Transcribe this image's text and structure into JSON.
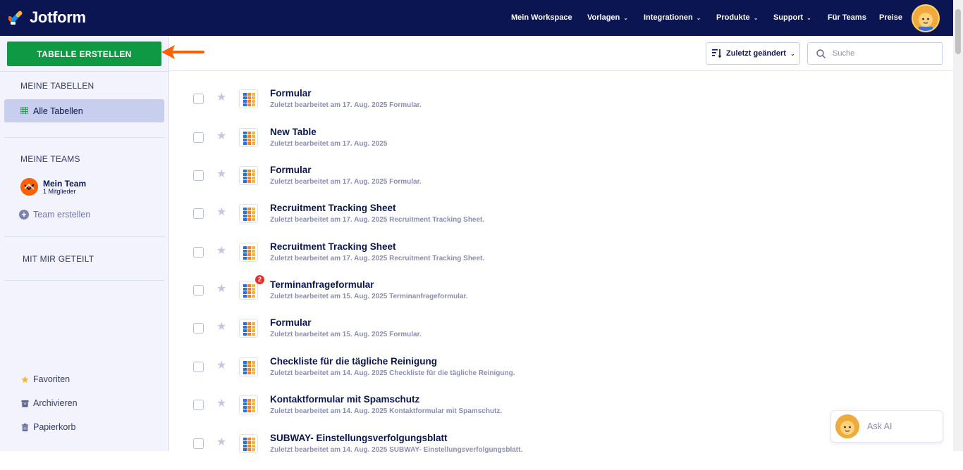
{
  "app": {
    "brand": "Jotform"
  },
  "nav": {
    "items": [
      {
        "label": "Mein Workspace",
        "dropdown": false
      },
      {
        "label": "Vorlagen",
        "dropdown": true
      },
      {
        "label": "Integrationen",
        "dropdown": true
      },
      {
        "label": "Produkte",
        "dropdown": true
      },
      {
        "label": "Support",
        "dropdown": true
      },
      {
        "label": "Für Teams",
        "dropdown": false
      },
      {
        "label": "Preise",
        "dropdown": false
      }
    ]
  },
  "sidebar": {
    "create_label": "TABELLE ERSTELLEN",
    "my_tables_heading": "MEINE TABELLEN",
    "all_tables_label": "Alle Tabellen",
    "my_teams_heading": "MEINE TEAMS",
    "team": {
      "name": "Mein Team",
      "members": "1 Mitglieder"
    },
    "create_team_label": "Team erstellen",
    "shared_heading": "MIT MIR GETEILT",
    "bottom": {
      "favorites": "Favoriten",
      "archive": "Archivieren",
      "trash": "Papierkorb"
    }
  },
  "toolbar": {
    "sort_label": "Zuletzt geändert",
    "search_placeholder": "Suche"
  },
  "list": [
    {
      "title": "Formular",
      "subtitle": "Zuletzt bearbeitet am 17. Aug. 2025 Formular.",
      "badge": ""
    },
    {
      "title": "New Table",
      "subtitle": "Zuletzt bearbeitet am 17. Aug. 2025",
      "badge": ""
    },
    {
      "title": "Formular",
      "subtitle": "Zuletzt bearbeitet am 17. Aug. 2025 Formular.",
      "badge": ""
    },
    {
      "title": "Recruitment Tracking Sheet",
      "subtitle": "Zuletzt bearbeitet am 17. Aug. 2025 Recruitment Tracking Sheet.",
      "badge": ""
    },
    {
      "title": "Recruitment Tracking Sheet",
      "subtitle": "Zuletzt bearbeitet am 17. Aug. 2025 Recruitment Tracking Sheet.",
      "badge": ""
    },
    {
      "title": "Terminanfrageformular",
      "subtitle": "Zuletzt bearbeitet am 15. Aug. 2025 Terminanfrageformular.",
      "badge": "2"
    },
    {
      "title": "Formular",
      "subtitle": "Zuletzt bearbeitet am 15. Aug. 2025 Formular.",
      "badge": ""
    },
    {
      "title": "Checkliste für die tägliche Reinigung",
      "subtitle": "Zuletzt bearbeitet am 14. Aug. 2025 Checkliste für die tägliche Reinigung.",
      "badge": ""
    },
    {
      "title": "Kontaktformular mit Spamschutz",
      "subtitle": "Zuletzt bearbeitet am 14. Aug. 2025 Kontaktformular mit Spamschutz.",
      "badge": ""
    },
    {
      "title": "SUBWAY- Einstellungsverfolgungsblatt",
      "subtitle": "Zuletzt bearbeitet am 14. Aug. 2025 SUBWAY- Einstellungsverfolgungsblatt.",
      "badge": ""
    }
  ],
  "ask_ai": {
    "label": "Ask AI"
  },
  "colors": {
    "navy": "#0a1551",
    "green": "#0f9942",
    "orange": "#ff6100",
    "sidebar_bg": "#f3f3fe"
  }
}
